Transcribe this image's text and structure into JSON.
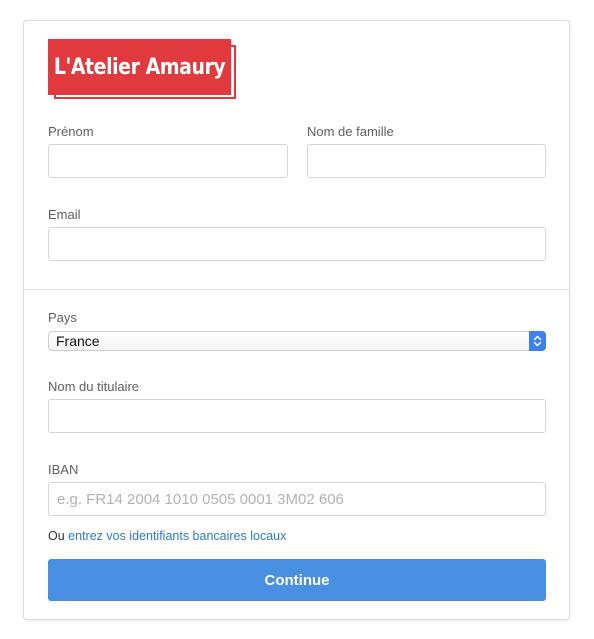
{
  "brand": {
    "name": "L'Atelier Amaury",
    "color": "#e03a3e"
  },
  "form": {
    "first_name": {
      "label": "Prénom",
      "value": ""
    },
    "last_name": {
      "label": "Nom de famille",
      "value": ""
    },
    "email": {
      "label": "Email",
      "value": ""
    },
    "country": {
      "label": "Pays",
      "selected": "France"
    },
    "holder_name": {
      "label": "Nom du titulaire",
      "value": ""
    },
    "iban": {
      "label": "IBAN",
      "placeholder": "e.g. FR14 2004 1010 0505 0001 3M02 606",
      "value": ""
    },
    "local_bank_prefix": "Ou",
    "local_bank_link": "entrez vos identifiants bancaires locaux",
    "submit_label": "Continue"
  },
  "colors": {
    "accent": "#4a90e2",
    "link": "#2f7bd8",
    "select_accent": "#3b82f0"
  }
}
